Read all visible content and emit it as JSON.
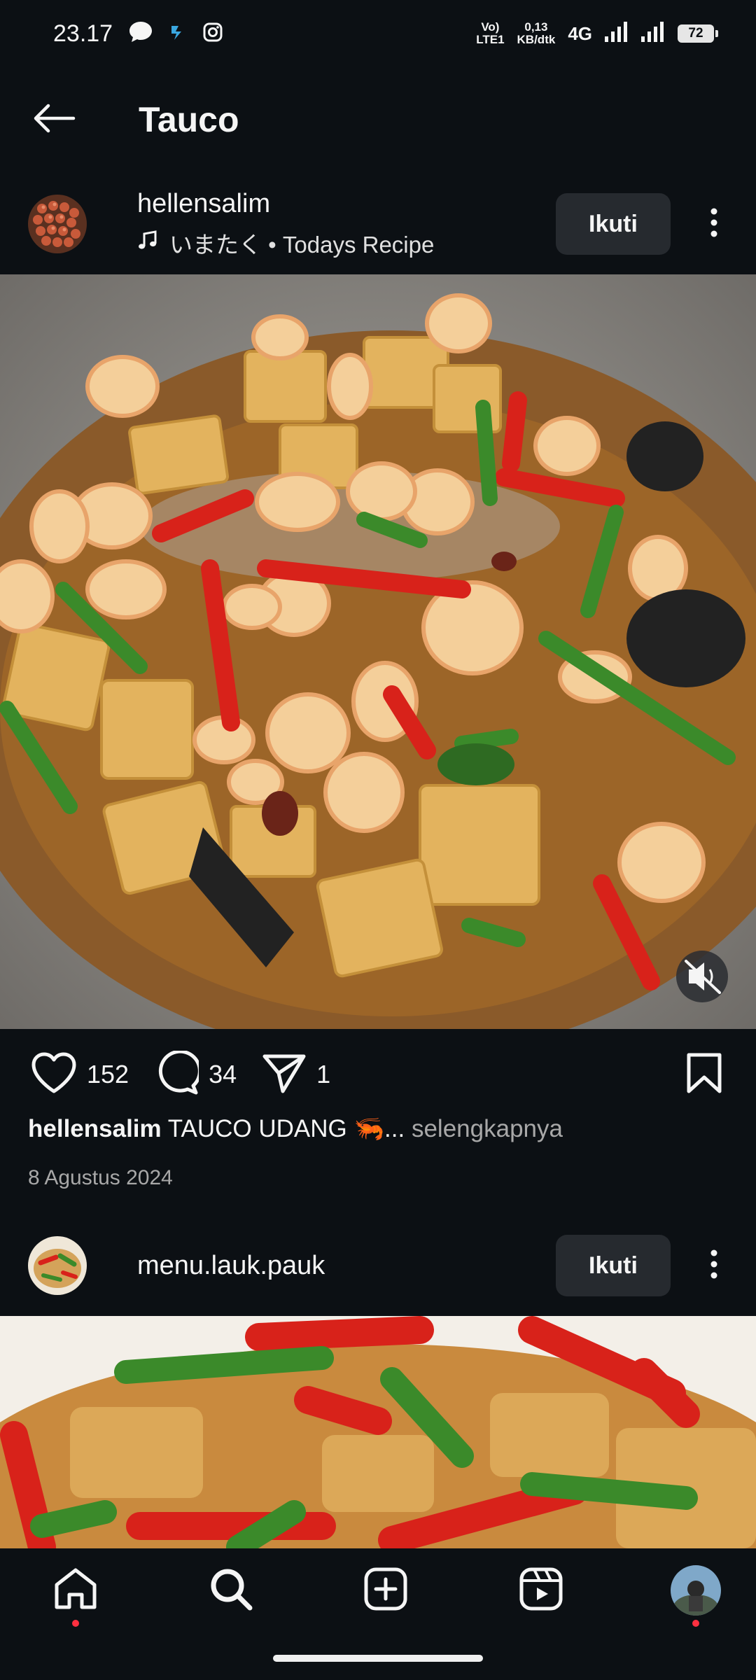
{
  "status_bar": {
    "time": "23.17",
    "volte": "Vo) LTE1",
    "volte_top": "Vo)",
    "volte_bottom": "LTE1",
    "speed_top": "0,13",
    "speed_bottom": "KB/dtk",
    "network": "4G",
    "battery": "72"
  },
  "header": {
    "title": "Tauco"
  },
  "posts": [
    {
      "username": "hellensalim",
      "audio": "いまたく • Todays Recipe",
      "follow_label": "Ikuti",
      "likes": "152",
      "comments": "34",
      "shares": "1",
      "caption_user": "hellensalim",
      "caption_text": "TAUCO UDANG 🦐... ",
      "caption_more": "selengkapnya",
      "date": "8 Agustus 2024"
    },
    {
      "username": "menu.lauk.pauk",
      "follow_label": "Ikuti"
    }
  ],
  "icons": {
    "back": "arrow-left-icon",
    "more": "more-vertical-icon",
    "music": "music-note-icon",
    "mute": "speaker-muted-icon",
    "like": "heart-icon",
    "comment": "comment-icon",
    "share": "send-icon",
    "save": "bookmark-icon",
    "home": "home-icon",
    "search": "search-icon",
    "create": "plus-square-icon",
    "reels": "reels-icon"
  },
  "colors": {
    "background": "#0c1014",
    "button": "#262a2f",
    "notification_dot": "#ff3040",
    "muted_text": "#a8a8a8"
  }
}
